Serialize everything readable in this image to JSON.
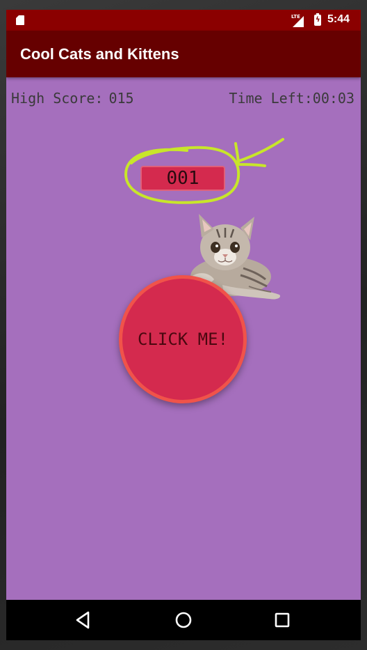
{
  "status_bar": {
    "network": "LTE",
    "time": "5:44",
    "icons": [
      "sd-card-icon",
      "lte-signal-icon",
      "battery-charging-icon"
    ]
  },
  "app_bar": {
    "title": "Cool Cats and Kittens"
  },
  "game": {
    "high_score_label": "High Score:",
    "high_score_value": "015",
    "time_left_label": "Time Left:",
    "time_left_value": "00:03",
    "counter_value": "001",
    "click_button_label": "CLICK ME!"
  },
  "colors": {
    "status_bar": "#8b0000",
    "app_bar": "#660000",
    "background": "#a56fbd",
    "counter_fill": "#d42a4e",
    "button_fill": "#d42a4e",
    "button_ring": "#f0534a",
    "annotation": "#c8e62a"
  },
  "nav_bar": {
    "icons": [
      "back-icon",
      "home-icon",
      "recents-icon"
    ]
  }
}
